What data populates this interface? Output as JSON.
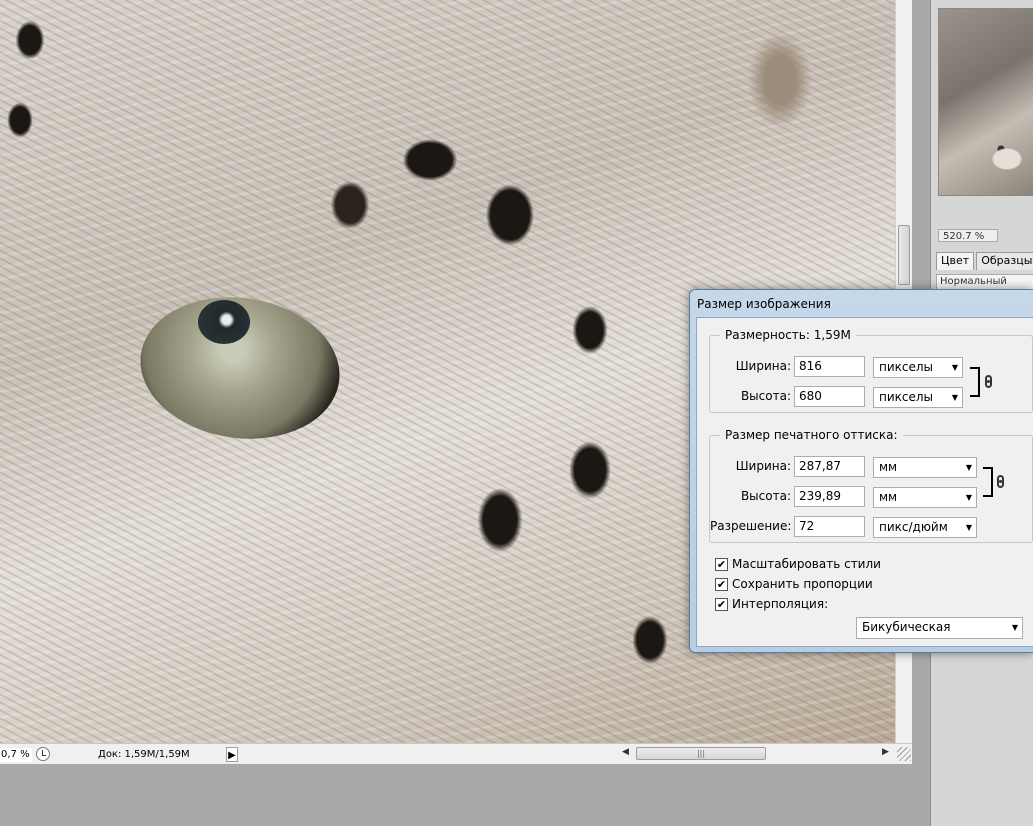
{
  "document": {
    "zoom": "0,7 %",
    "doc_info": "Док: 1,59M/1,59M",
    "status_arrow": "▶",
    "hscroll_grip": "|||"
  },
  "navigator": {
    "zoom": "520.7 %"
  },
  "panel": {
    "tabs": [
      "Цвет",
      "Образцы"
    ],
    "blend_mode": "Нормальный"
  },
  "dialog": {
    "title": "Размер изображения",
    "pixel_dimensions": {
      "legend": "Размерность:",
      "size": "1,59M",
      "width_label": "Ширина:",
      "width_value": "816",
      "width_unit": "пикселы",
      "height_label": "Высота:",
      "height_value": "680",
      "height_unit": "пикселы"
    },
    "document_size": {
      "legend": "Размер печатного оттиска:",
      "width_label": "Ширина:",
      "width_value": "287,87",
      "width_unit": "мм",
      "height_label": "Высота:",
      "height_value": "239,89",
      "height_unit": "мм",
      "resolution_label": "Разрешение:",
      "resolution_value": "72",
      "resolution_unit": "пикс/дюйм"
    },
    "checkboxes": [
      {
        "label": "Масштабировать стили",
        "checked": true
      },
      {
        "label": "Сохранить пропорции",
        "checked": true
      },
      {
        "label": "Интерполяция:",
        "checked": true
      }
    ],
    "resample_method": "Бикубическая"
  }
}
